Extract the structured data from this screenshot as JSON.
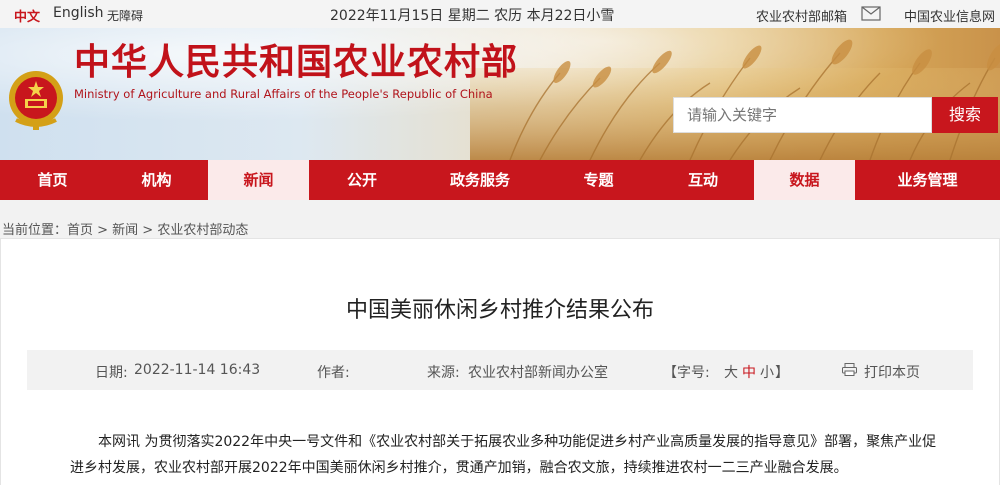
{
  "topbar": {
    "lang_cn": "中文",
    "lang_en": "English",
    "accessibility": "无障碍",
    "date": "2022年11月15日 星期二 农历 本月22日小雪",
    "mailbox": "农业农村部邮箱",
    "info_net": "中国农业信息网"
  },
  "header": {
    "title": "中华人民共和国农业农村部",
    "subtitle": "Ministry of Agriculture and Rural Affairs of the People's Republic of China",
    "search_placeholder": "请输入关键字",
    "search_button": "搜索"
  },
  "nav": {
    "items": [
      {
        "label": "首页",
        "active": false
      },
      {
        "label": "机构",
        "active": false
      },
      {
        "label": "新闻",
        "active": true
      },
      {
        "label": "公开",
        "active": false
      },
      {
        "label": "政务服务",
        "active": false
      },
      {
        "label": "专题",
        "active": false
      },
      {
        "label": "互动",
        "active": false
      },
      {
        "label": "数据",
        "active": true
      },
      {
        "label": "业务管理",
        "active": false
      }
    ]
  },
  "breadcrumb": "当前位置：首页 > 新闻 > 农业农村部动态",
  "article": {
    "title": "中国美丽休闲乡村推介结果公布",
    "date_label": "日期:",
    "date": "2022-11-14 16:43",
    "author_label": "作者:",
    "source_label": "来源:",
    "source": "农业农村部新闻办公室",
    "font_size_open": "【字号:",
    "font_large": "大",
    "font_medium": "中",
    "font_small": "小",
    "font_size_close": "】",
    "print": "打印本页",
    "paragraph": "本网讯 为贯彻落实2022年中央一号文件和《农业农村部关于拓展农业多种功能促进乡村产业高质量发展的指导意见》部署，聚焦产业促进乡村发展，农业农村部开展2022年中国美丽休闲乡村推介，贯通产加销，融合农文旅，持续推进农村一二三产业融合发展。"
  },
  "colors": {
    "brand_red": "#c8161d",
    "nav_active_bg": "#fbeaea"
  }
}
